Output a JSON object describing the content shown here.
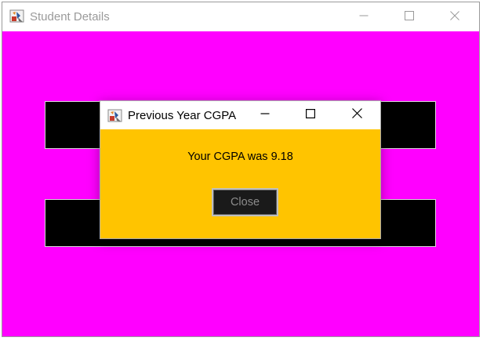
{
  "main_window": {
    "title": "Student Details",
    "icon": "java-app-icon",
    "controls": [
      "minimize-icon",
      "maximize-icon",
      "close-icon"
    ]
  },
  "content": {
    "background_color": "#ff00ff",
    "panel_color": "#000000"
  },
  "dialog": {
    "title": "Previous Year CGPA",
    "icon": "java-app-icon",
    "controls": [
      "minimize-icon",
      "maximize-icon",
      "close-icon"
    ],
    "background_color": "#ffc400",
    "message": "Your CGPA was 9.18",
    "close_button_label": "Close"
  }
}
